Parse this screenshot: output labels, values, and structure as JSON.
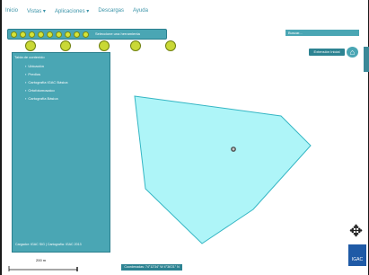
{
  "menu": [
    "Inicio",
    "Vistas ▾",
    "Aplicaciones ▾",
    "Descargas",
    "Ayuda"
  ],
  "toolbar": {
    "tooltip": "Seleccione una herramienta"
  },
  "panel": {
    "header": "Tabla de contenido",
    "layers": [
      "Ubicación",
      "Predios",
      "Cartografía IGAC Básica",
      "Ortofotomosaico",
      "Cartografía Básica"
    ],
    "footer": "Cargador: IGAC SIG | Cartografía: IGAC 2013"
  },
  "search": {
    "placeholder": "Buscar..."
  },
  "buttons": {
    "full_extent": "Extensión Inicial",
    "coords": "Coordenadas: 74°12'34\" W 4°36'21\" N"
  },
  "scale": {
    "label": "200 m"
  },
  "logo": {
    "text": "IGAC"
  },
  "colors": {
    "accent": "#4aa6b4",
    "polygon_fill": "#aef5f8",
    "polygon_stroke": "#35b6c4"
  }
}
